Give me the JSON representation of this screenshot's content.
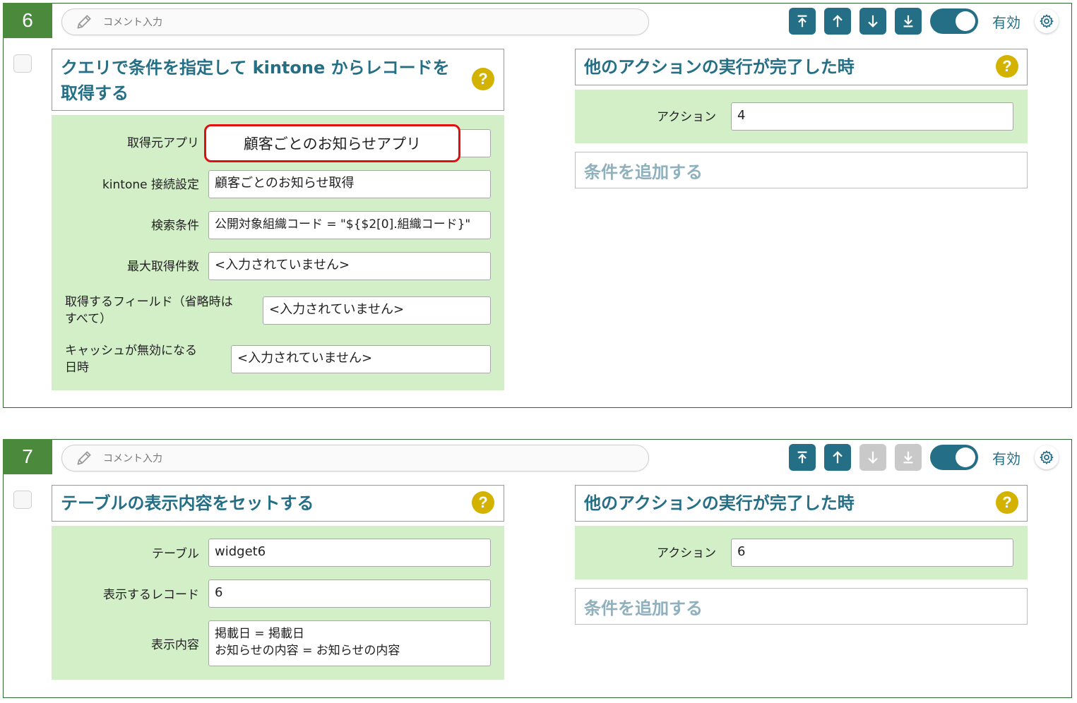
{
  "blocks": [
    {
      "number": "6",
      "comment_placeholder": "コメント入力",
      "enabled_label": "有効",
      "action": {
        "title_line1": "クエリで条件を指定して kintone からレコードを",
        "title_line2": "取得する",
        "help": "?",
        "fields": [
          {
            "label": "取得元アプリ",
            "value": "顧客ごとのお知らせアプリ"
          },
          {
            "label": "kintone 接続設定",
            "value": "顧客ごとのお知らせ取得"
          },
          {
            "label": "検索条件",
            "value": "公開対象組織コード = \"${$2[0].組織コード}\""
          },
          {
            "label": "最大取得件数",
            "value": "<入力されていません>"
          },
          {
            "label": "取得するフィールド（省略時は\nすべて）",
            "value": "<入力されていません>"
          },
          {
            "label": "キャッシュが無効になる\n日時",
            "value": "<入力されていません>"
          }
        ]
      },
      "trigger": {
        "title": "他のアクションの実行が完了した時",
        "help": "?",
        "action_label": "アクション",
        "action_value": "4",
        "add_condition": "条件を追加する"
      }
    },
    {
      "number": "7",
      "comment_placeholder": "コメント入力",
      "enabled_label": "有効",
      "action": {
        "title_line1": "テーブルの表示内容をセットする",
        "help": "?",
        "fields": [
          {
            "label": "テーブル",
            "value": "widget6"
          },
          {
            "label": "表示するレコード",
            "value": "6"
          },
          {
            "label": "表示内容",
            "value": "掲載日 = 掲載日\nお知らせの内容 = お知らせの内容"
          }
        ]
      },
      "trigger": {
        "title": "他のアクションの実行が完了した時",
        "help": "?",
        "action_label": "アクション",
        "action_value": "6",
        "add_condition": "条件を追加する"
      }
    }
  ],
  "colors": {
    "accent": "#256f86",
    "block_number_bg": "#4b8a3d",
    "panel_bg": "#d2efc8",
    "help_icon": "#d4b200",
    "highlight_border": "#e01010",
    "disabled_button": "#c9c9c9"
  },
  "icons": [
    "pencil-icon",
    "move-top-icon",
    "move-up-icon",
    "move-down-icon",
    "move-bottom-icon",
    "gear-icon",
    "help-icon"
  ]
}
